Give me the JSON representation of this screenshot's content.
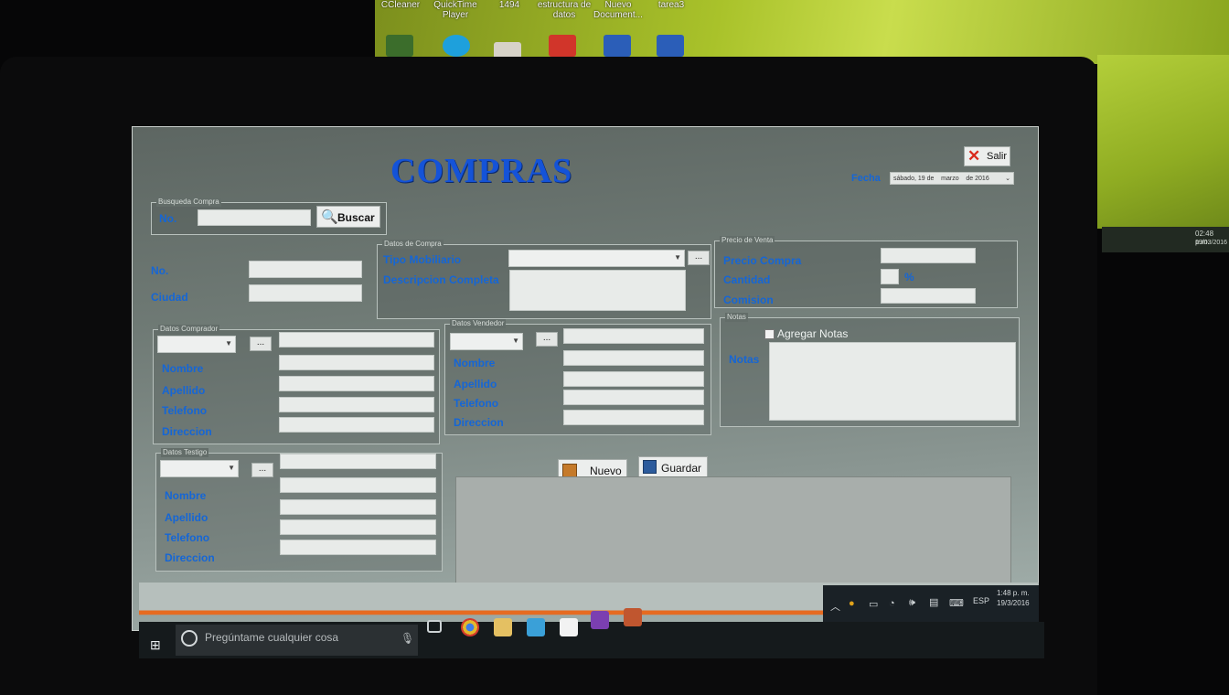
{
  "background": {
    "desktop_icons": [
      "CCleaner",
      "QuickTime Player",
      "1494",
      "estructura de datos",
      "Nuevo Document...",
      "tarea3"
    ],
    "tray_time": "02:48 p.m.",
    "tray_date": "19/03/2016",
    "colors": {
      "wallpaper": "#a9c22a"
    }
  },
  "app": {
    "title": "COMPRAS",
    "exit_label": "Salir",
    "fecha_label": "Fecha",
    "date": {
      "weekday": "sábado",
      "day": "19 de",
      "month": "marzo",
      "year": "de 2016"
    },
    "busqueda": {
      "group_title": "Busqueda Compra",
      "label": "No.",
      "value": "",
      "button_label": "Buscar"
    },
    "no_label": "No.",
    "ciudad_label": "Ciudad",
    "datos_compra": {
      "group_title": "Datos de Compra",
      "tipo_label": "Tipo Mobiliario",
      "descripcion_label": "Descripcion Completa",
      "dots": "..."
    },
    "precio_venta": {
      "group_title": "Precio de Venta",
      "precio_label": "Precio Compra",
      "cantidad_label": "Cantidad",
      "percent": "%",
      "comision_label": "Comision"
    },
    "comprador": {
      "group_title": "Datos Comprador",
      "dots": "...",
      "nombre": "Nombre",
      "apellido": "Apellido",
      "telefono": "Telefono",
      "direccion": "Direccion"
    },
    "vendedor": {
      "group_title": "Datos Vendedor",
      "dots": "...",
      "nombre": "Nombre",
      "apellido": "Apellido",
      "telefono": "Telefono",
      "direccion": "Direccion"
    },
    "testigo": {
      "group_title": "Datos Testigo",
      "dots": "...",
      "nombre": "Nombre",
      "apellido": "Apellido",
      "telefono": "Telefono",
      "direccion": "Direccion"
    },
    "notas": {
      "group_title": "Notas",
      "checkbox_label": "Agregar Notas",
      "label": "Notas"
    },
    "nuevo_label": "Nuevo",
    "guardar_label": "Guardar",
    "colors": {
      "label_blue": "#1566d6",
      "title_blue": "#1453d8"
    }
  },
  "taskbar": {
    "search_placeholder": "Pregúntame cualquier cosa",
    "time": "1:48 p. m.",
    "date": "19/3/2016",
    "lang": "ESP",
    "icons": [
      "windows-icon",
      "task-view-icon",
      "chrome-icon",
      "file-explorer-icon",
      "media-player-icon",
      "store-icon",
      "visual-studio-icon",
      "app-icon"
    ]
  }
}
